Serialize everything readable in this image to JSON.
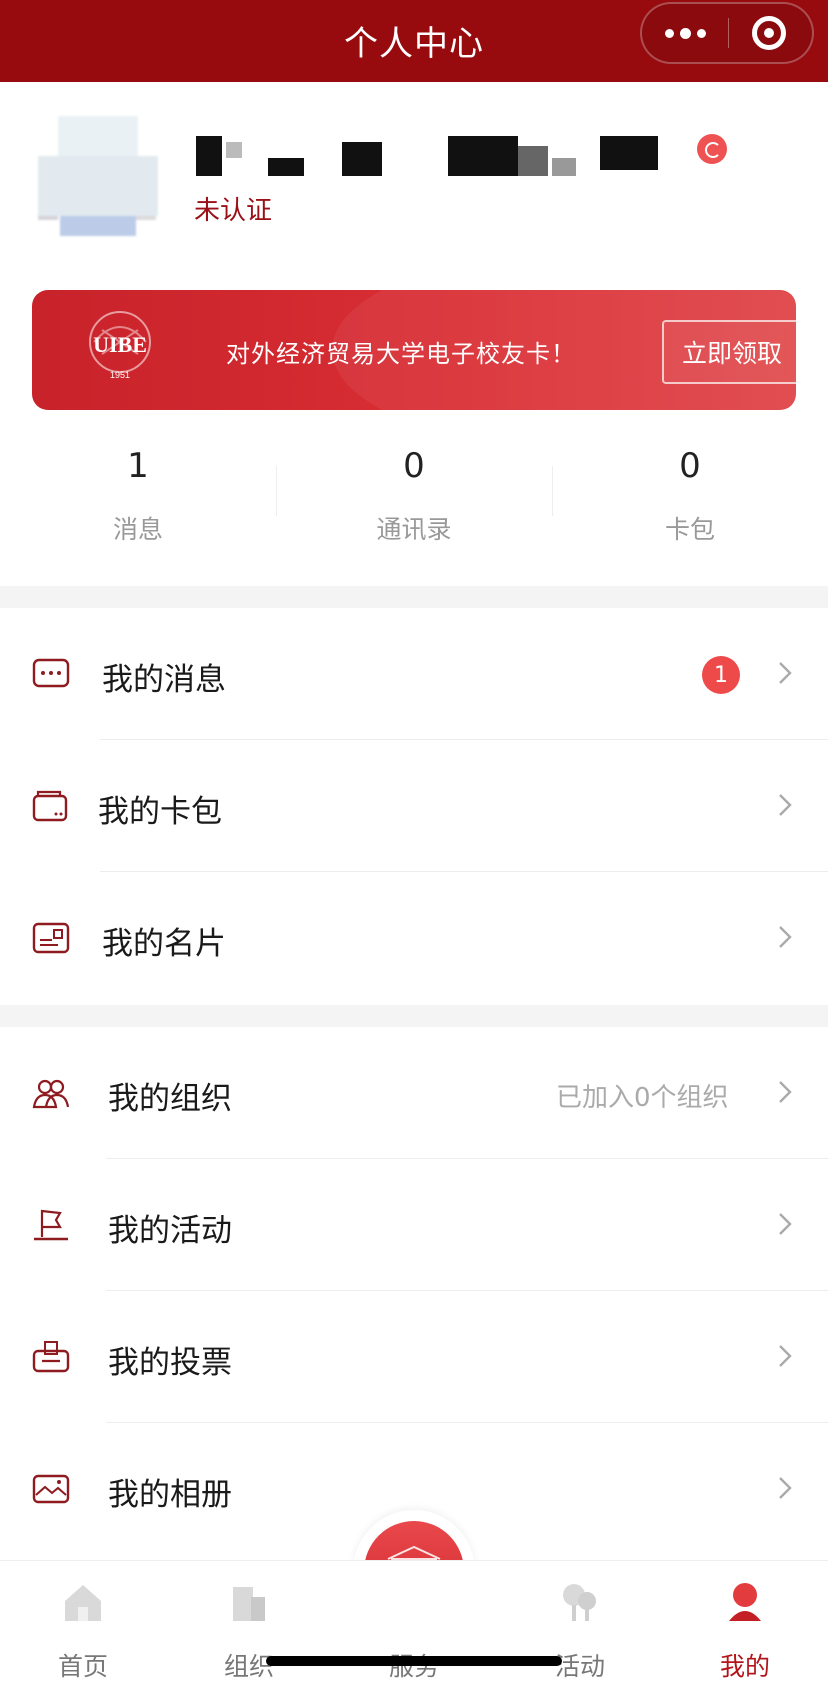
{
  "navbar": {
    "title": "个人中心"
  },
  "profile": {
    "auth_status": "未认证"
  },
  "banner": {
    "text": "对外经济贸易大学电子校友卡！",
    "button": "立即领取",
    "logo_year": "1951"
  },
  "stats": [
    {
      "value": "1",
      "label": "消息"
    },
    {
      "value": "0",
      "label": "通讯录"
    },
    {
      "value": "0",
      "label": "卡包"
    }
  ],
  "menu_group1": [
    {
      "label": "我的消息",
      "icon": "message-icon",
      "badge": "1"
    },
    {
      "label": "我的卡包",
      "icon": "wallet-icon"
    },
    {
      "label": "我的名片",
      "icon": "business-card-icon"
    }
  ],
  "menu_group2": [
    {
      "label": "我的组织",
      "icon": "people-icon",
      "hint": "已加入0个组织"
    },
    {
      "label": "我的活动",
      "icon": "flag-icon"
    },
    {
      "label": "我的投票",
      "icon": "ballot-box-icon"
    },
    {
      "label": "我的相册",
      "icon": "photo-album-icon"
    }
  ],
  "tabbar": [
    {
      "label": "首页",
      "icon": "home-icon"
    },
    {
      "label": "组织",
      "icon": "buildings-icon"
    },
    {
      "label": "服务",
      "icon": "university-logo-icon"
    },
    {
      "label": "活动",
      "icon": "trees-icon"
    },
    {
      "label": "我的",
      "icon": "profile-icon",
      "active": true
    }
  ],
  "colors": {
    "brand_red": "#970b0f",
    "accent_red": "#d92e34",
    "badge_red": "#ee4a4a"
  }
}
